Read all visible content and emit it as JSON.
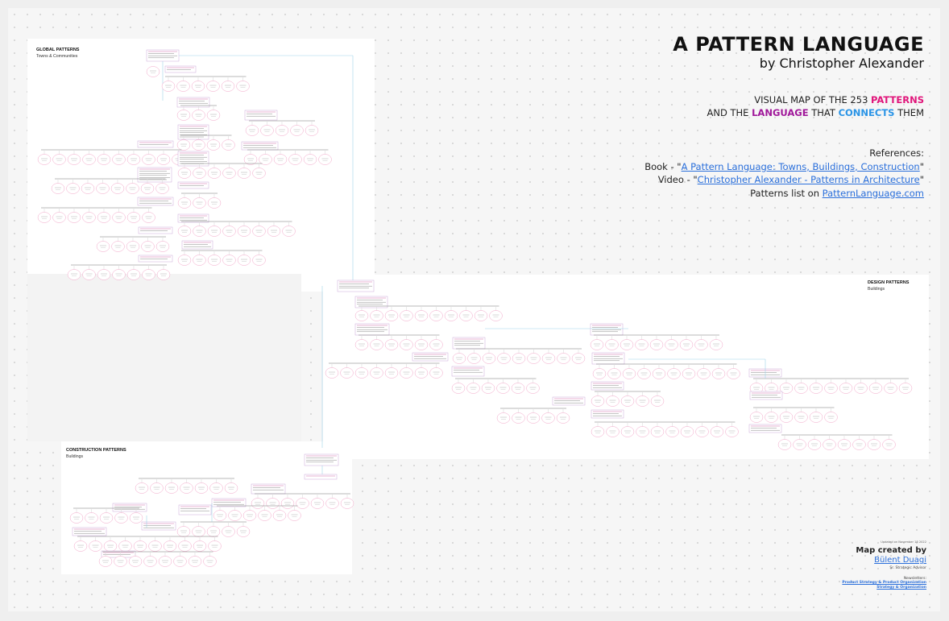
{
  "header": {
    "title": "A PATTERN LANGUAGE",
    "author_line": "by Christopher Alexander",
    "tagline_1a": "VISUAL MAP OF THE 253 ",
    "tagline_1b": "PATTERNS",
    "tagline_2a": "AND THE ",
    "tagline_2b": "LANGUAGE",
    "tagline_2c": " THAT ",
    "tagline_2d": "CONNECTS",
    "tagline_2e": " THEM"
  },
  "references": {
    "heading": "References:",
    "book_prefix": "Book - \"",
    "book_link": "A Pattern Language: Towns, Buildings, Construction",
    "book_suffix": "\"",
    "video_prefix": "Video - \"",
    "video_link": "Christopher Alexander -  Patterns in Architecture",
    "video_suffix": "\"",
    "list_prefix": "Patterns list on ",
    "list_link": "PatternLanguage.com"
  },
  "panels": {
    "global": {
      "title": "GLOBAL PATTERNS",
      "subtitle": "Towns & Communities"
    },
    "design": {
      "title": "DESIGN PATTERNS",
      "subtitle": "Buildings"
    },
    "construction": {
      "title": "CONSTRUCTION PATTERNS",
      "subtitle": "Buildings"
    }
  },
  "credits": {
    "updated": "Updated on November 18 2022",
    "made_by": "Map created by",
    "author": "Bülent Duagi",
    "role": "Sr. Strategic Advisor",
    "newsletters": "Newsletters:",
    "newsletter_1": "Product Strategy & Product Organization",
    "newsletter_2": "Strategy & Organization"
  },
  "colors": {
    "node_border": "#f2a6c8",
    "connector": "#9fd3ea",
    "accent_pink": "#e0157a",
    "accent_purple": "#a0189a",
    "accent_blue": "#2a94e6"
  }
}
